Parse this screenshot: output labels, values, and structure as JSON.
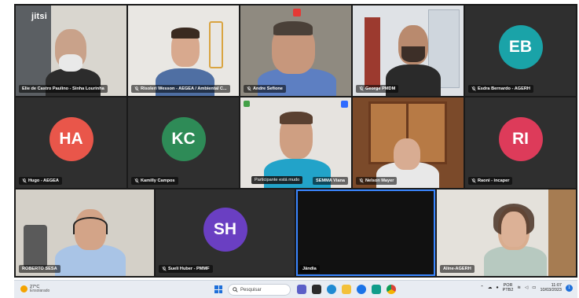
{
  "app": {
    "logo_text": "jitsi"
  },
  "tiles": [
    {
      "name": "Elie de Castro Paulino - Sinha Lourinha",
      "type": "video"
    },
    {
      "name": "Risoleri Wesson - AEGEA / Ambiental C...",
      "type": "video"
    },
    {
      "name": "Andre Sefione",
      "type": "video"
    },
    {
      "name": "George PMDM",
      "type": "video"
    },
    {
      "name": "Esdra Bernardo - AGERH",
      "type": "avatar",
      "initials": "EB",
      "color": "#1aa3a8"
    },
    {
      "name": "Hugo - AEGEA",
      "type": "avatar",
      "initials": "HA",
      "color": "#e9564a"
    },
    {
      "name": "Kamilly Campos",
      "type": "avatar",
      "initials": "KC",
      "color": "#2e8b57"
    },
    {
      "name": "SEMMA Viana",
      "type": "video",
      "tooltip": "Participante está mudo"
    },
    {
      "name": "Nelson Mayer",
      "type": "video"
    },
    {
      "name": "Raoni - incaper",
      "type": "avatar",
      "initials": "RI",
      "color": "#dd3b5a"
    },
    {
      "name": "ROBERTO SESA",
      "type": "video"
    },
    {
      "name": "Sueli Huber - PMMF",
      "type": "avatar",
      "initials": "SH",
      "color": "#6a3fc2"
    },
    {
      "name": "Jândia",
      "type": "black"
    },
    {
      "name": "Aline-AGERH",
      "type": "video"
    }
  ],
  "taskbar": {
    "weather_temp": "27°C",
    "weather_cond": "Ensolarado",
    "search_placeholder": "Pesquisar",
    "lang_line1": "POR",
    "lang_line2": "PTB2",
    "time": "11:07",
    "date": "10/03/2023",
    "notif_count": "1"
  }
}
